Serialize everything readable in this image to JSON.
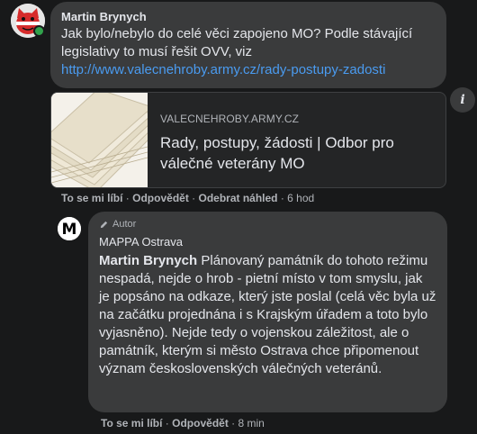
{
  "comment1": {
    "author": "Martin Brynych",
    "text": "Jak bylo/nebylo do celé věci zapojeno MO? Podle stávající legislativy to musí řešit OVV, viz",
    "link": "http://www.valecnehroby.army.cz/rady-postupy-zadosti"
  },
  "preview": {
    "domain": "VALECNEHROBY.ARMY.CZ",
    "title": "Rady, postupy, žádosti | Odbor pro válečné veterány MO",
    "info_label": "i"
  },
  "comment1_actions": {
    "like": "To se mi líbí",
    "reply": "Odpovědět",
    "remove_preview": "Odebrat náhled",
    "sep": " · ",
    "time": "6 hod"
  },
  "comment2": {
    "badge": "Autor",
    "page_name": "MAPPA Ostrava",
    "mention": "Martin Brynych",
    "text": "Plánovaný památník do tohoto režimu nespadá, nejde o hrob - pietní místo v tom smyslu, jak je popsáno na odkaze, který jste poslal (celá věc byla už na začátku projednána i s Krajským úřadem a toto bylo vyjasněno). Nejde tedy o vojenskou záležitost, ale o památník, kterým si město Ostrava chce připomenout význam československých válečných veteránů.",
    "avatar_letter": "M"
  },
  "comment2_actions": {
    "like": "To se mi líbí",
    "reply": "Odpovědět",
    "sep": " · ",
    "time": "8 min"
  },
  "colors": {
    "background": "#18191a",
    "bubble": "#3a3b3c",
    "link": "#4a9bf0",
    "secondary_text": "#b0b3b8",
    "online": "#31a24c"
  }
}
